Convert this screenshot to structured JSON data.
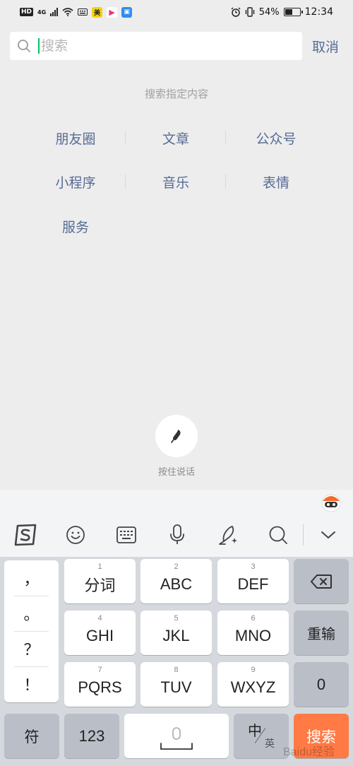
{
  "status_bar": {
    "hd": "HD",
    "network": "4G",
    "app_mei": "美",
    "battery_percent": "54%",
    "battery_level": 0.54,
    "time": "12:34"
  },
  "search": {
    "placeholder": "搜索",
    "value": "",
    "cancel_label": "取消"
  },
  "specify": {
    "title": "搜索指定内容",
    "categories": [
      "朋友圈",
      "文章",
      "公众号",
      "小程序",
      "音乐",
      "表情",
      "服务"
    ]
  },
  "voice": {
    "label": "按住说话"
  },
  "keyboard": {
    "punctuation": [
      "，",
      "。",
      "？",
      "！"
    ],
    "keys": [
      {
        "num": "1",
        "label": "分词"
      },
      {
        "num": "2",
        "label": "ABC"
      },
      {
        "num": "3",
        "label": "DEF"
      },
      {
        "num": "4",
        "label": "GHI"
      },
      {
        "num": "5",
        "label": "JKL"
      },
      {
        "num": "6",
        "label": "MNO"
      },
      {
        "num": "7",
        "label": "PQRS"
      },
      {
        "num": "8",
        "label": "TUV"
      },
      {
        "num": "9",
        "label": "WXYZ"
      }
    ],
    "reinput": "重输",
    "zero": "0",
    "symbols": "符",
    "numbers": "123",
    "lang": "中",
    "lang_sub": "英",
    "search": "搜索"
  },
  "watermark": "Baidu经验"
}
